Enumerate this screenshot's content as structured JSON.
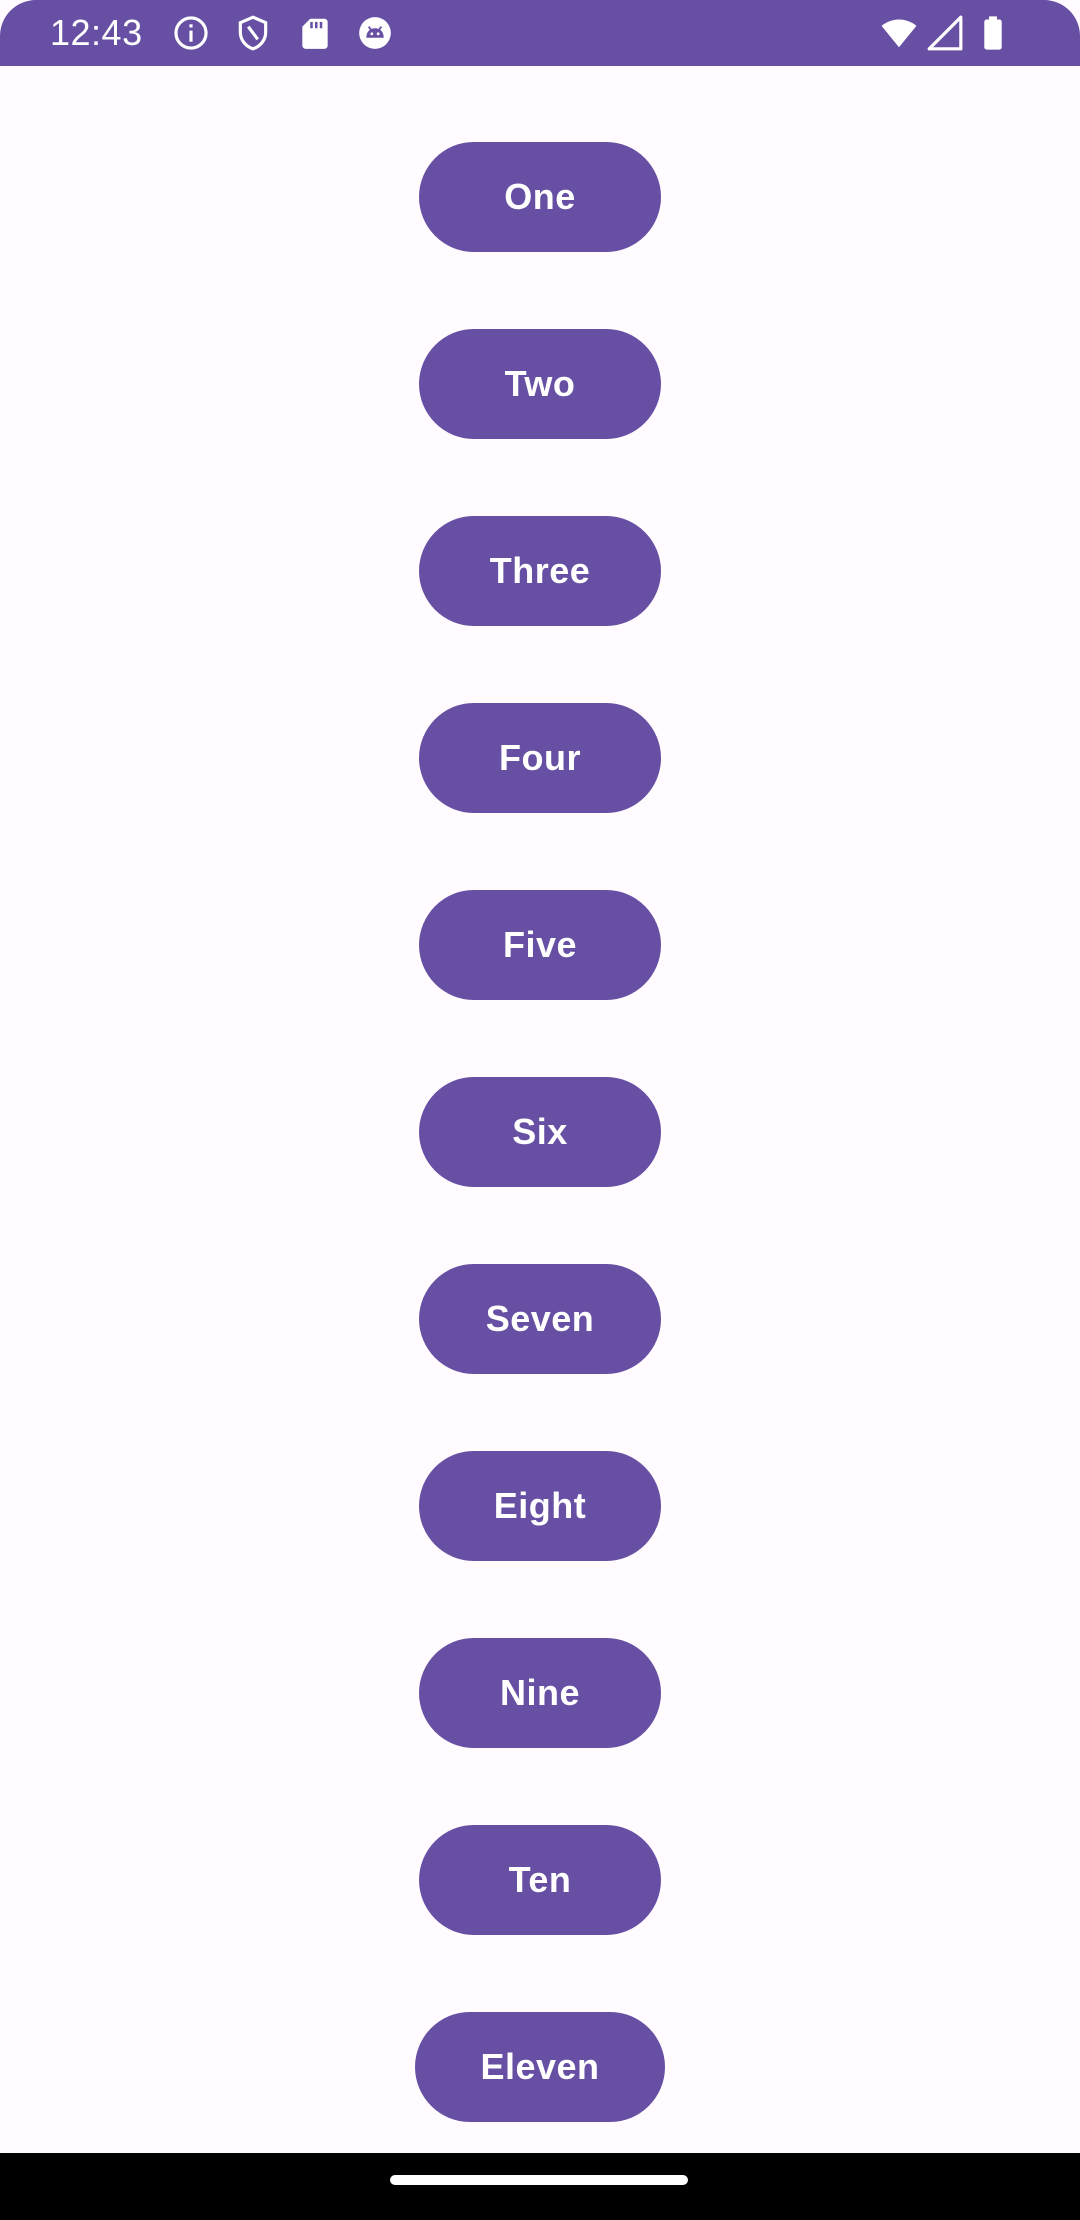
{
  "status_bar": {
    "time": "12:43",
    "background": "#6750A4",
    "left_icons": [
      "info-icon",
      "shield-icon",
      "sd-card-icon",
      "android-debug-icon"
    ],
    "right_icons": [
      "wifi-icon",
      "cell-signal-icon",
      "battery-icon"
    ]
  },
  "theme": {
    "primary": "#6750A4",
    "on_primary": "#FFFFFF",
    "background": "#FFFBFE"
  },
  "buttons": [
    {
      "label": "One"
    },
    {
      "label": "Two"
    },
    {
      "label": "Three"
    },
    {
      "label": "Four"
    },
    {
      "label": "Five"
    },
    {
      "label": "Six"
    },
    {
      "label": "Seven"
    },
    {
      "label": "Eight"
    },
    {
      "label": "Nine"
    },
    {
      "label": "Ten"
    },
    {
      "label": "Eleven"
    }
  ]
}
